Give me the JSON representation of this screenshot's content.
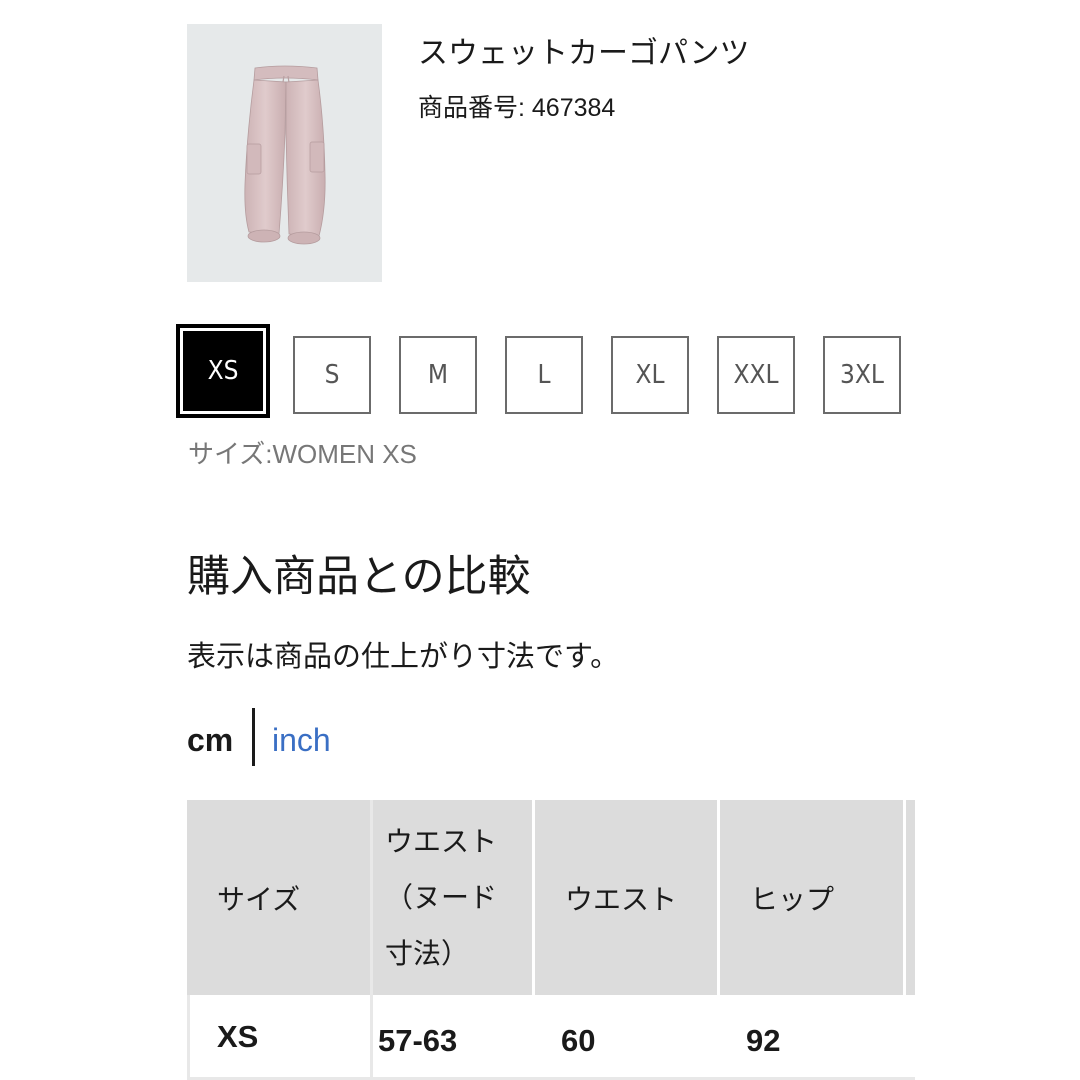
{
  "product": {
    "name": "スウェットカーゴパンツ",
    "number_label": "商品番号: 467384"
  },
  "sizes": {
    "options": [
      "XS",
      "S",
      "M",
      "L",
      "XL",
      "XXL",
      "3XL"
    ],
    "selected": "XS",
    "caption": "サイズ:WOMEN XS"
  },
  "comparison": {
    "title": "購入商品との比較",
    "note": "表示は商品の仕上がり寸法です。"
  },
  "units": {
    "cm": "cm",
    "inch": "inch",
    "active": "cm",
    "link_color": "#3a6fc4"
  },
  "table": {
    "headers": [
      "サイズ",
      "ウエスト\n（ヌード\n寸法）",
      "ウエスト",
      "ヒップ"
    ],
    "rows": [
      [
        "XS",
        "57-63",
        "60",
        "92"
      ]
    ]
  },
  "colors": {
    "selected_bg": "#000000",
    "header_bg": "#dcdcdc",
    "thumb_bg": "#e6e9ea",
    "product_color": "#d9c3c4"
  }
}
